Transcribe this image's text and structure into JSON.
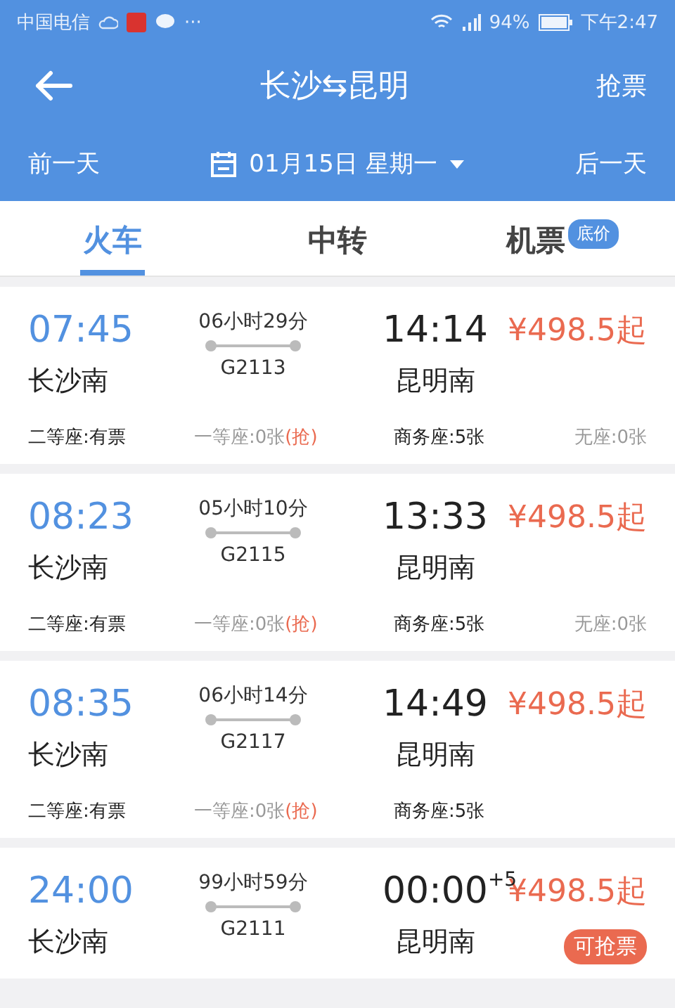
{
  "status_bar": {
    "carrier": "中国电信",
    "more": "···",
    "battery": "94%",
    "time": "下午2:47"
  },
  "header": {
    "title": "长沙⇆昆明",
    "action": "抢票"
  },
  "date_bar": {
    "prev": "前一天",
    "date": "01月15日 星期一",
    "next": "后一天"
  },
  "tabs": [
    {
      "label": "火车",
      "selected": true
    },
    {
      "label": "中转",
      "selected": false
    },
    {
      "label": "机票",
      "selected": false,
      "badge": "底价"
    }
  ],
  "trains": [
    {
      "depart_time": "07:45",
      "depart_station": "长沙南",
      "duration": "06小时29分",
      "train_no": "G2113",
      "arrive_time": "14:14",
      "arrive_station": "昆明南",
      "price": "¥498.5起",
      "seats": [
        {
          "label": "二等座:有票",
          "available": true
        },
        {
          "label": "一等座:0张",
          "available": false,
          "grab": "(抢)"
        },
        {
          "label": "商务座:5张",
          "available": true
        },
        {
          "label": "无座:0张",
          "available": false
        }
      ]
    },
    {
      "depart_time": "08:23",
      "depart_station": "长沙南",
      "duration": "05小时10分",
      "train_no": "G2115",
      "arrive_time": "13:33",
      "arrive_station": "昆明南",
      "price": "¥498.5起",
      "seats": [
        {
          "label": "二等座:有票",
          "available": true
        },
        {
          "label": "一等座:0张",
          "available": false,
          "grab": "(抢)"
        },
        {
          "label": "商务座:5张",
          "available": true
        },
        {
          "label": "无座:0张",
          "available": false
        }
      ]
    },
    {
      "depart_time": "08:35",
      "depart_station": "长沙南",
      "duration": "06小时14分",
      "train_no": "G2117",
      "arrive_time": "14:49",
      "arrive_station": "昆明南",
      "price": "¥498.5起",
      "seats": [
        {
          "label": "二等座:有票",
          "available": true
        },
        {
          "label": "一等座:0张",
          "available": false,
          "grab": "(抢)"
        },
        {
          "label": "商务座:5张",
          "available": true
        }
      ]
    },
    {
      "depart_time": "24:00",
      "depart_station": "长沙南",
      "duration": "99小时59分",
      "train_no": "G2111",
      "arrive_time": "00:00",
      "day_offset": "+5",
      "arrive_station": "昆明南",
      "price": "¥498.5起",
      "badge": "可抢票"
    }
  ]
}
